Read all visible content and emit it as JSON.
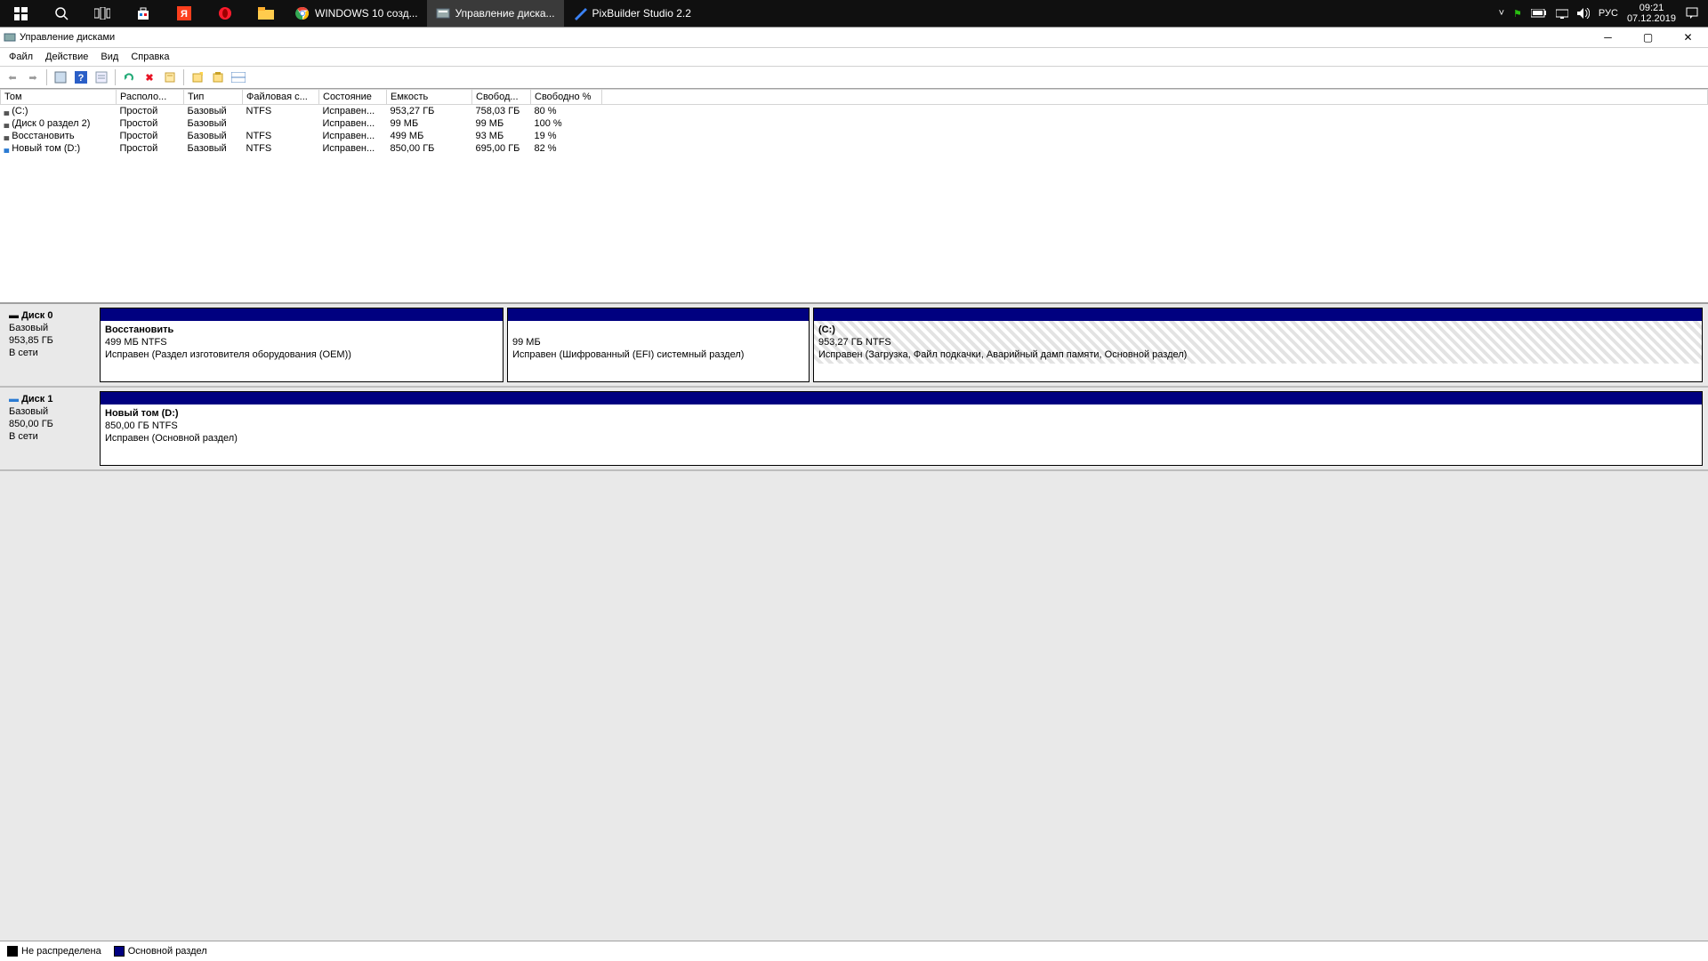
{
  "taskbar": {
    "items": [
      {
        "label": "WINDOWS 10 созд..."
      },
      {
        "label": "Управление диска..."
      },
      {
        "label": "PixBuilder Studio 2.2"
      }
    ],
    "lang": "РУС",
    "time": "09:21",
    "date": "07.12.2019"
  },
  "window": {
    "title": "Управление дисками",
    "menu": {
      "file": "Файл",
      "action": "Действие",
      "view": "Вид",
      "help": "Справка"
    }
  },
  "columns": {
    "c0": "Том",
    "c1": "Располо...",
    "c2": "Тип",
    "c3": "Файловая с...",
    "c4": "Состояние",
    "c5": "Емкость",
    "c6": "Свобод...",
    "c7": "Свободно %"
  },
  "rows": [
    {
      "vol": "(C:)",
      "layout": "Простой",
      "type": "Базовый",
      "fs": "NTFS",
      "status": "Исправен...",
      "cap": "953,27 ГБ",
      "free": "758,03 ГБ",
      "pct": "80 %"
    },
    {
      "vol": "(Диск 0 раздел 2)",
      "layout": "Простой",
      "type": "Базовый",
      "fs": "",
      "status": "Исправен...",
      "cap": "99 МБ",
      "free": "99 МБ",
      "pct": "100 %"
    },
    {
      "vol": "Восстановить",
      "layout": "Простой",
      "type": "Базовый",
      "fs": "NTFS",
      "status": "Исправен...",
      "cap": "499 МБ",
      "free": "93 МБ",
      "pct": "19 %"
    },
    {
      "vol": "Новый том (D:)",
      "layout": "Простой",
      "type": "Базовый",
      "fs": "NTFS",
      "status": "Исправен...",
      "cap": "850,00 ГБ",
      "free": "695,00 ГБ",
      "pct": "82 %"
    }
  ],
  "disk0": {
    "name": "Диск 0",
    "type": "Базовый",
    "size": "953,85 ГБ",
    "status": "В сети",
    "p0": {
      "title": "Восстановить",
      "line2": "499 МБ NTFS",
      "line3": "Исправен (Раздел изготовителя оборудования (OEM))"
    },
    "p1": {
      "line2": "99 МБ",
      "line3": "Исправен (Шифрованный (EFI) системный раздел)"
    },
    "p2": {
      "title": "(C:)",
      "line2": "953,27 ГБ NTFS",
      "line3": "Исправен (Загрузка, Файл подкачки, Аварийный дамп памяти, Основной раздел)"
    }
  },
  "disk1": {
    "name": "Диск 1",
    "type": "Базовый",
    "size": "850,00 ГБ",
    "status": "В сети",
    "p0": {
      "title": "Новый том  (D:)",
      "line2": "850,00 ГБ NTFS",
      "line3": "Исправен (Основной раздел)"
    }
  },
  "legend": {
    "unalloc": "Не распределена",
    "primary": "Основной раздел"
  }
}
